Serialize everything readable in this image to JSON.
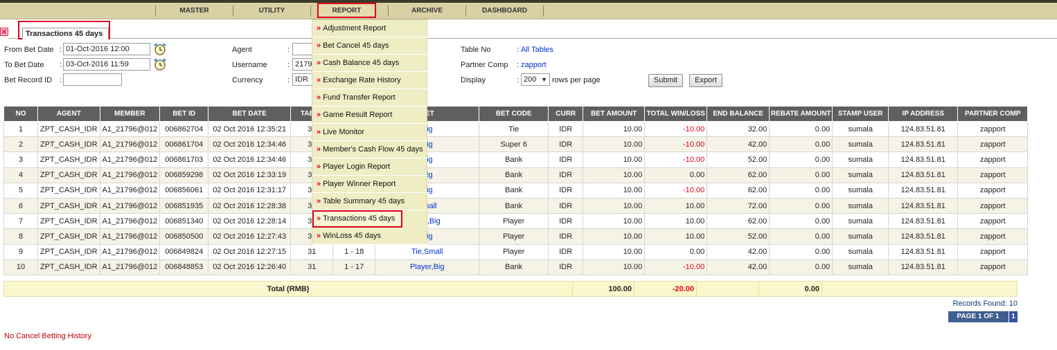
{
  "nav": {
    "items": [
      "MASTER",
      "UTILITY",
      "REPORT",
      "ARCHIVE",
      "DASHBOARD"
    ]
  },
  "tab": {
    "label": "Transactions 45 days"
  },
  "filters": {
    "from_bet_date_label": "From Bet Date",
    "from_bet_date": "01-Oct-2016 12:00",
    "to_bet_date_label": "To Bet Date",
    "to_bet_date": "03-Oct-2016 11:59",
    "bet_record_id_label": "Bet Record ID",
    "bet_record_id": "",
    "agent_label": "Agent",
    "agent_value": "",
    "username_label": "Username",
    "username_value": "2179",
    "currency_label": "Currency",
    "currency_value": "IDR",
    "table_no_label": "Table No",
    "table_no_value": "All Tables",
    "partner_comp_label": "Partner Comp",
    "partner_comp_value": "zapport",
    "display_label": "Display",
    "display_value": "200",
    "rows_per_page": "rows per page",
    "colon": ":"
  },
  "buttons": {
    "submit": "Submit",
    "export": "Export"
  },
  "menu": {
    "items": [
      "Adjustment Report",
      "Bet Cancel 45 days",
      "Cash Balance 45 days",
      "Exchange Rate History",
      "Fund Transfer Report",
      "Game Result Report",
      "Live Monitor",
      "Member's Cash Flow 45 days",
      "Player Login Report",
      "Player Winner Report",
      "Table Summary 45 days",
      "Transactions 45 days",
      "WinLoss 45 days"
    ],
    "marker": "»"
  },
  "table": {
    "headers": [
      "NO",
      "AGENT",
      "MEMBER",
      "BET ID",
      "BET DATE",
      "TABLE",
      "",
      "BET",
      "BET CODE",
      "CURR",
      "BET AMOUNT",
      "TOTAL WIN/LOSS",
      "END BALANCE",
      "REBATE AMOUNT",
      "STAMP USER",
      "IP ADDRESS",
      "PARTNER COMP"
    ],
    "rows": [
      [
        "1",
        "ZPT_CASH_IDR",
        "A1_21796@012",
        "006862704",
        "02 Oct 2016 12:35:21",
        "31",
        "",
        "Big",
        "Tie",
        "IDR",
        "10.00",
        "-10.00",
        "32.00",
        "0.00",
        "sumala",
        "124.83.51.81",
        "zapport"
      ],
      [
        "2",
        "ZPT_CASH_IDR",
        "A1_21796@012",
        "006861704",
        "02 Oct 2016 12:34:46",
        "31",
        "",
        "Big",
        "Super 6",
        "IDR",
        "10.00",
        "-10.00",
        "42.00",
        "0.00",
        "sumala",
        "124.83.51.81",
        "zapport"
      ],
      [
        "3",
        "ZPT_CASH_IDR",
        "A1_21796@012",
        "006861703",
        "02 Oct 2016 12:34:46",
        "31",
        "",
        "Big",
        "Bank",
        "IDR",
        "10.00",
        "-10.00",
        "52.00",
        "0.00",
        "sumala",
        "124.83.51.81",
        "zapport"
      ],
      [
        "4",
        "ZPT_CASH_IDR",
        "A1_21796@012",
        "006859298",
        "02 Oct 2016 12:33:19",
        "31",
        "",
        "Big",
        "Bank",
        "IDR",
        "10.00",
        "0.00",
        "62.00",
        "0.00",
        "sumala",
        "124.83.51.81",
        "zapport"
      ],
      [
        "5",
        "ZPT_CASH_IDR",
        "A1_21796@012",
        "006856061",
        "02 Oct 2016 12:31:17",
        "31",
        "",
        "Big",
        "Bank",
        "IDR",
        "10.00",
        "-10.00",
        "62.00",
        "0.00",
        "sumala",
        "124.83.51.81",
        "zapport"
      ],
      [
        "6",
        "ZPT_CASH_IDR",
        "A1_21796@012",
        "006851935",
        "02 Oct 2016 12:28:38",
        "31",
        "",
        "Small",
        "Bank",
        "IDR",
        "10.00",
        "10.00",
        "72.00",
        "0.00",
        "sumala",
        "124.83.51.81",
        "zapport"
      ],
      [
        "7",
        "ZPT_CASH_IDR",
        "A1_21796@012",
        "006851340",
        "02 Oct 2016 12:28:14",
        "31",
        "",
        "Pair,Big",
        "Player",
        "IDR",
        "10.00",
        "10.00",
        "62.00",
        "0.00",
        "sumala",
        "124.83.51.81",
        "zapport"
      ],
      [
        "8",
        "ZPT_CASH_IDR",
        "A1_21796@012",
        "006850500",
        "02 Oct 2016 12:27:43",
        "31",
        "",
        "Big",
        "Player",
        "IDR",
        "10.00",
        "10.00",
        "52.00",
        "0.00",
        "sumala",
        "124.83.51.81",
        "zapport"
      ],
      [
        "9",
        "ZPT_CASH_IDR",
        "A1_21796@012",
        "006849824",
        "02 Oct 2016 12:27:15",
        "31",
        "1 - 18",
        "Tie,Small",
        "Player",
        "IDR",
        "10.00",
        "0.00",
        "42.00",
        "0.00",
        "sumala",
        "124.83.51.81",
        "zapport"
      ],
      [
        "10",
        "ZPT_CASH_IDR",
        "A1_21796@012",
        "006848853",
        "02 Oct 2016 12:26:40",
        "31",
        "1 - 17",
        "Player,Big",
        "Bank",
        "IDR",
        "10.00",
        "-10.00",
        "42.00",
        "0.00",
        "sumala",
        "124.83.51.81",
        "zapport"
      ]
    ],
    "total_label": "Total (RMB)",
    "total_bet_amount": "100.00",
    "total_win_loss": "-20.00",
    "total_rebate": "0.00"
  },
  "footer": {
    "records_found": "Records Found: 10",
    "page_label": "PAGE 1 OF 1",
    "page_number": "1",
    "no_cancel": "No Cancel Betting History"
  },
  "colors": {
    "accent_red": "#e0001b",
    "nav_bg": "#d9d0a5",
    "header_bg": "#5f5f5f",
    "menu_bg": "#efedc4",
    "link_blue": "#0033cc"
  }
}
